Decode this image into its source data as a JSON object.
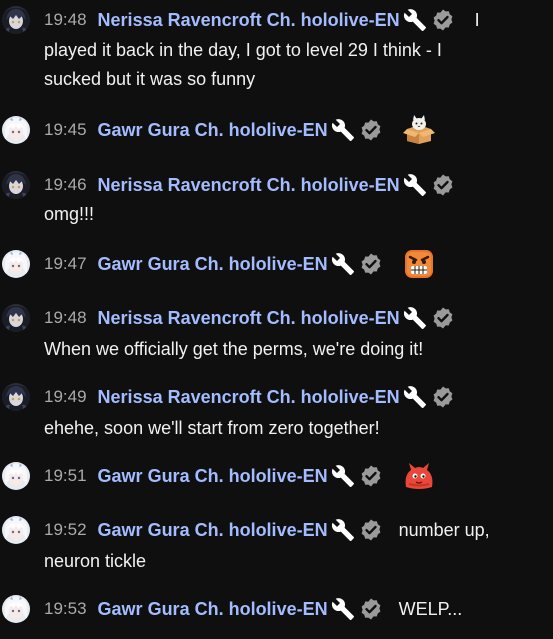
{
  "colors": {
    "background": "#0f0f0f",
    "author_name": "#a3bcff",
    "timestamp": "#aaaaaa",
    "message_text": "#f1f1f1"
  },
  "messages": [
    {
      "time": "19:48",
      "author": "Nerissa Ravencroft Ch. hololive-EN",
      "avatar": "nerissa-avatar",
      "badges": [
        "wrench-icon",
        "verified-icon"
      ],
      "inline": "I",
      "text": "played it back in the day, I got to level 29 I think - I\nsucked but it was so funny"
    },
    {
      "time": "19:45",
      "author": "Gawr Gura Ch. hololive-EN",
      "avatar": "gura-avatar",
      "badges": [
        "wrench-icon",
        "verified-icon"
      ],
      "emoji": "box-cat-emoji"
    },
    {
      "time": "19:46",
      "author": "Nerissa Ravencroft Ch. hololive-EN",
      "avatar": "nerissa-avatar",
      "badges": [
        "wrench-icon",
        "verified-icon"
      ],
      "text": "omg!!!"
    },
    {
      "time": "19:47",
      "author": "Gawr Gura Ch. hololive-EN",
      "avatar": "gura-avatar",
      "badges": [
        "wrench-icon",
        "verified-icon"
      ],
      "emoji": "angry-face-emoji"
    },
    {
      "time": "19:48",
      "author": "Nerissa Ravencroft Ch. hololive-EN",
      "avatar": "nerissa-avatar",
      "badges": [
        "wrench-icon",
        "verified-icon"
      ],
      "text": "When we officially get the perms, we're doing it!"
    },
    {
      "time": "19:49",
      "author": "Nerissa Ravencroft Ch. hololive-EN",
      "avatar": "nerissa-avatar",
      "badges": [
        "wrench-icon",
        "verified-icon"
      ],
      "text": "ehehe, soon we'll start from zero together!"
    },
    {
      "time": "19:51",
      "author": "Gawr Gura Ch. hololive-EN",
      "avatar": "gura-avatar",
      "badges": [
        "wrench-icon",
        "verified-icon"
      ],
      "emoji": "red-blob-emoji"
    },
    {
      "time": "19:52",
      "author": "Gawr Gura Ch. hololive-EN",
      "avatar": "gura-avatar",
      "badges": [
        "wrench-icon",
        "verified-icon"
      ],
      "inline": "number up,",
      "text": "neuron tickle"
    },
    {
      "time": "19:53",
      "author": "Gawr Gura Ch. hololive-EN",
      "avatar": "gura-avatar",
      "badges": [
        "wrench-icon",
        "verified-icon"
      ],
      "inline": "WELP..."
    }
  ]
}
